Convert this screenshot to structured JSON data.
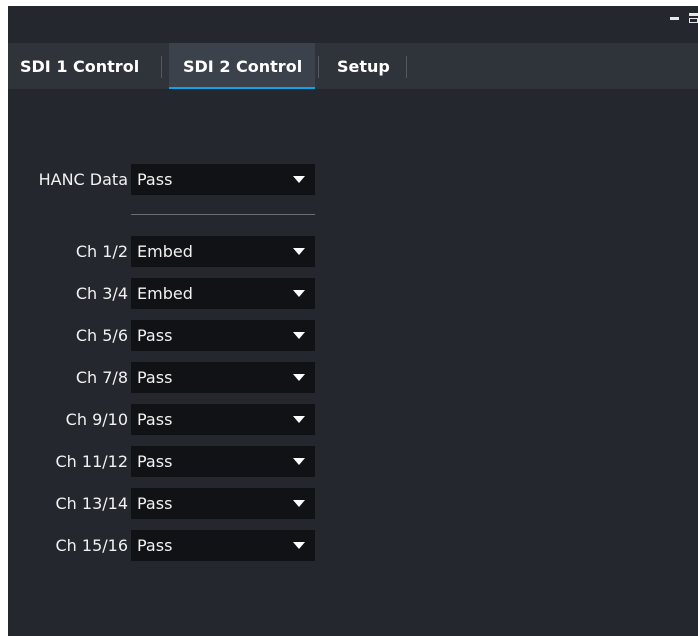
{
  "tabs": [
    {
      "label": "SDI 1 Control",
      "active": false
    },
    {
      "label": "SDI 2 Control",
      "active": true
    },
    {
      "label": "Setup",
      "active": false
    }
  ],
  "hanc": {
    "label": "HANC Data",
    "value": "Pass"
  },
  "channels": [
    {
      "label": "Ch 1/2",
      "value": "Embed"
    },
    {
      "label": "Ch 3/4",
      "value": "Embed"
    },
    {
      "label": "Ch 5/6",
      "value": "Pass"
    },
    {
      "label": "Ch 7/8",
      "value": "Pass"
    },
    {
      "label": "Ch 9/10",
      "value": "Pass"
    },
    {
      "label": "Ch 11/12",
      "value": "Pass"
    },
    {
      "label": "Ch 13/14",
      "value": "Pass"
    },
    {
      "label": "Ch 15/16",
      "value": "Pass"
    }
  ],
  "colors": {
    "accent": "#0aa5e6",
    "background": "#24272d",
    "tabbar": "#2f333a",
    "dropdown": "#111215"
  },
  "icons": {
    "dropdown": "caret-down-icon",
    "window_minimize": "minimize-icon",
    "window_restore": "restore-icon"
  }
}
